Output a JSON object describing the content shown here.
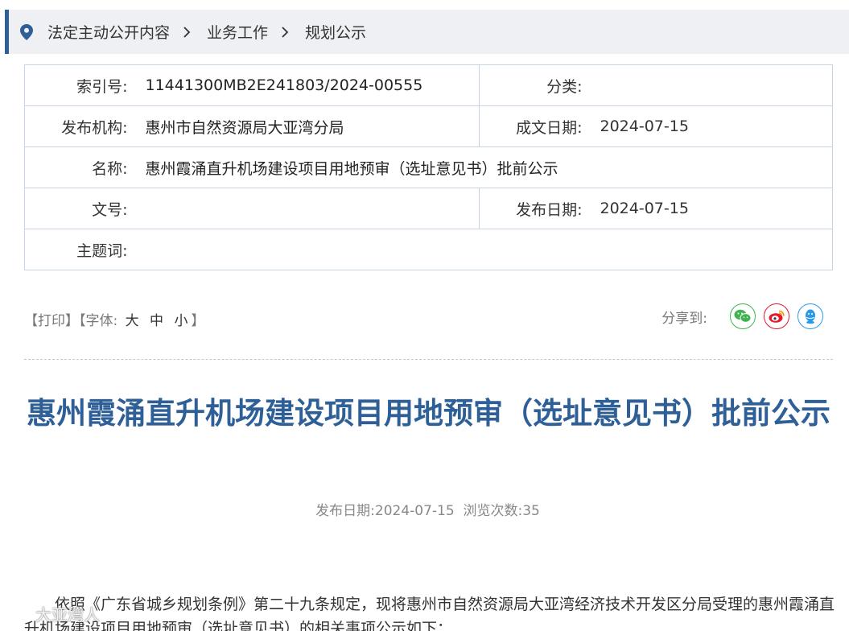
{
  "breadcrumb": {
    "items": [
      "法定主动公开内容",
      "业务工作",
      "规划公示"
    ]
  },
  "meta": {
    "index_label": "索引号:",
    "index_value": "11441300MB2E241803/2024-00555",
    "category_label": "分类:",
    "category_value": "",
    "publisher_label": "发布机构:",
    "publisher_value": "惠州市自然资源局大亚湾分局",
    "written_date_label": "成文日期:",
    "written_date_value": "2024-07-15",
    "name_label": "名称:",
    "name_value": "惠州霞涌直升机场建设项目用地预审（选址意见书）批前公示",
    "doc_no_label": "文号:",
    "doc_no_value": "",
    "publish_date_label": "发布日期:",
    "publish_date_value": "2024-07-15",
    "keywords_label": "主题词:",
    "keywords_value": ""
  },
  "tools": {
    "print": "【打印】",
    "font_prefix": "【字体:",
    "font_large": "大",
    "font_medium": "中",
    "font_small": "小",
    "font_suffix": "】"
  },
  "share": {
    "label": "分享到:",
    "icons": [
      "wechat-icon",
      "weibo-icon",
      "qq-icon"
    ],
    "colors": {
      "wechat": "#3fb34f",
      "weibo": "#e6162d",
      "qq": "#2a9ae8"
    }
  },
  "article": {
    "title": "惠州霞涌直升机场建设项目用地预审（选址意见书）批前公示",
    "publish_date_label": "发布日期:",
    "publish_date": "2024-07-15",
    "views_label": "浏览次数:",
    "views": "35",
    "body": "依照《广东省城乡规划条例》第二十九条规定，现将惠州市自然资源局大亚湾经济技术开发区分局受理的惠州霞涌直升机场建设项目用地预审（选址意见书）的相关事项公示如下："
  },
  "watermark": "大亚湾人",
  "colors": {
    "accent": "#2f5f97",
    "breadcrumb_bg": "#eef0f3",
    "table_border": "#c9d4e3"
  }
}
